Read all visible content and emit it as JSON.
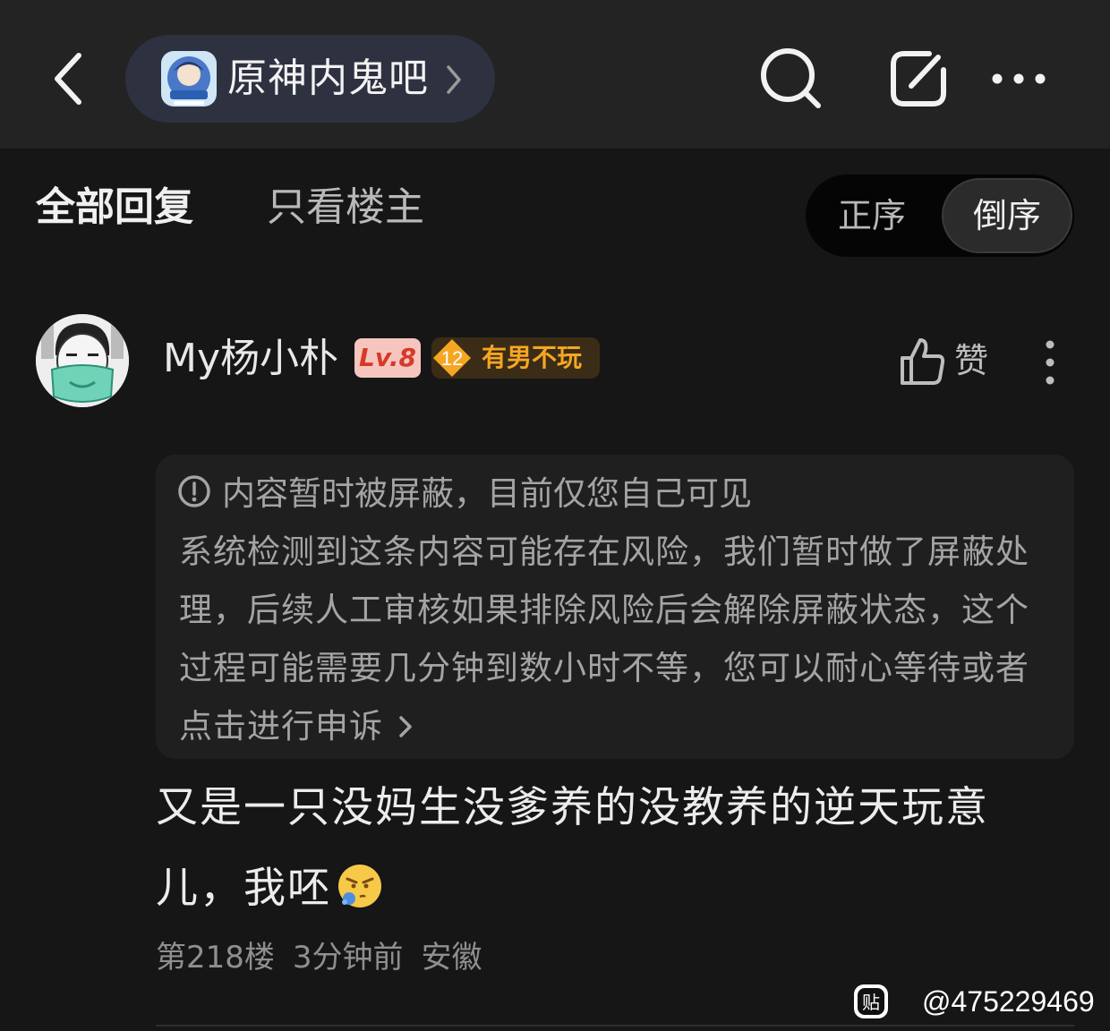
{
  "header": {
    "forum_name": "原神内鬼吧"
  },
  "sort_bar": {
    "tab_all": "全部回复",
    "tab_op_only": "只看楼主",
    "order_asc": "正序",
    "order_desc": "倒序",
    "selected_order": "倒序"
  },
  "post": {
    "username": "My杨小朴",
    "level_badge": "Lv.8",
    "title_badge_level": "12",
    "title_badge_text": "有男不玩",
    "like_label": "赞",
    "notice": {
      "title": "内容暂时被屏蔽，目前仅您自己可见",
      "body": "系统检测到这条内容可能存在风险，我们暂时做了屏蔽处理，后续人工审核如果排除风险后会解除屏蔽状态，这个过程可能需要几分钟到数小时不等，您可以耐心等待或者",
      "appeal_link": "点击进行申诉"
    },
    "content": "又是一只没妈生没爹养的没教养的逆天玩意儿，我呸",
    "floor": "第218楼",
    "time": "3分钟前",
    "location": "安徽"
  },
  "watermark": {
    "text": "@475229469",
    "logo_char": "贴"
  },
  "colors": {
    "background": "#161616",
    "topbar": "#232323",
    "forum_pill": "#2e3140",
    "level_badge_bg": "#f6c6be",
    "level_badge_text": "#d63a2a",
    "title_badge_text": "#f5a623"
  },
  "icons": [
    "back-arrow-icon",
    "forum-logo-icon",
    "chevron-right-icon",
    "search-icon",
    "edit-icon",
    "more-horizontal-icon",
    "thumbs-up-icon",
    "more-vertical-icon",
    "info-icon",
    "spitting-face-emoji",
    "tieba-logo-icon"
  ]
}
